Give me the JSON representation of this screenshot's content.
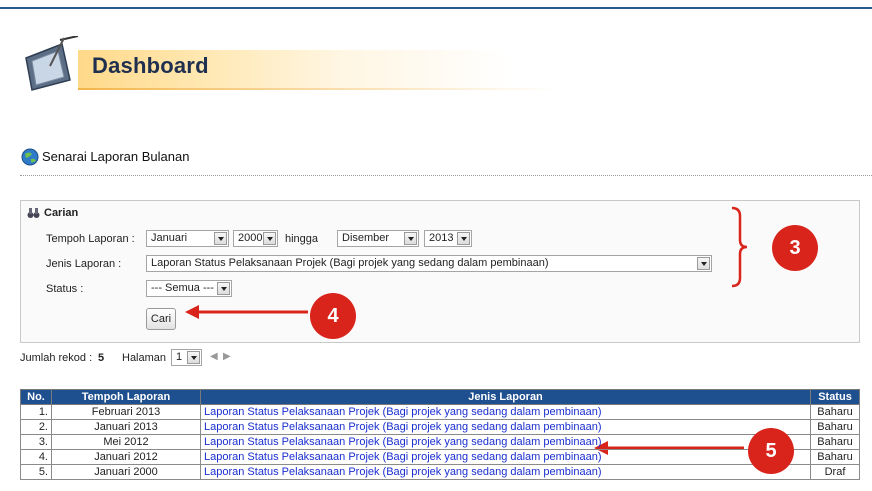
{
  "header": {
    "title": "Dashboard"
  },
  "section": {
    "title": "Senarai Laporan Bulanan"
  },
  "search": {
    "title": "Carian",
    "tempoh_label": "Tempoh Laporan :",
    "from_month": "Januari",
    "from_year": "2000",
    "to_label": "hingga",
    "to_month": "Disember",
    "to_year": "2013",
    "jenis_label": "Jenis Laporan :",
    "jenis_value": "Laporan Status Pelaksanaan Projek (Bagi projek yang sedang dalam pembinaan)",
    "status_label": "Status :",
    "status_value": "--- Semua ---",
    "button_label": "Cari"
  },
  "annotations": {
    "badge3": "3",
    "badge4": "4",
    "badge5": "5",
    "color": "#d9241b"
  },
  "pager": {
    "count_label": "Jumlah rekod :",
    "count_value": "5",
    "page_label": "Halaman",
    "page_value": "1"
  },
  "table": {
    "headers": [
      "No.",
      "Tempoh Laporan",
      "Jenis Laporan",
      "Status"
    ],
    "rows": [
      {
        "no": "1.",
        "tempoh": "Februari 2013",
        "jenis": "Laporan Status Pelaksanaan Projek (Bagi projek yang sedang dalam pembinaan)",
        "status": "Baharu"
      },
      {
        "no": "2.",
        "tempoh": "Januari 2013",
        "jenis": "Laporan Status Pelaksanaan Projek (Bagi projek yang sedang dalam pembinaan)",
        "status": "Baharu"
      },
      {
        "no": "3.",
        "tempoh": "Mei 2012",
        "jenis": "Laporan Status Pelaksanaan Projek (Bagi projek yang sedang dalam pembinaan)",
        "status": "Baharu"
      },
      {
        "no": "4.",
        "tempoh": "Januari 2012",
        "jenis": "Laporan Status Pelaksanaan Projek (Bagi projek yang sedang dalam pembinaan)",
        "status": "Baharu"
      },
      {
        "no": "5.",
        "tempoh": "Januari 2000",
        "jenis": "Laporan Status Pelaksanaan Projek (Bagi projek yang sedang dalam pembinaan)",
        "status": "Draf"
      }
    ]
  },
  "colors": {
    "header_bg": "#1e4f8f",
    "link": "#1a2ecf",
    "banner": "#ffd98a"
  }
}
